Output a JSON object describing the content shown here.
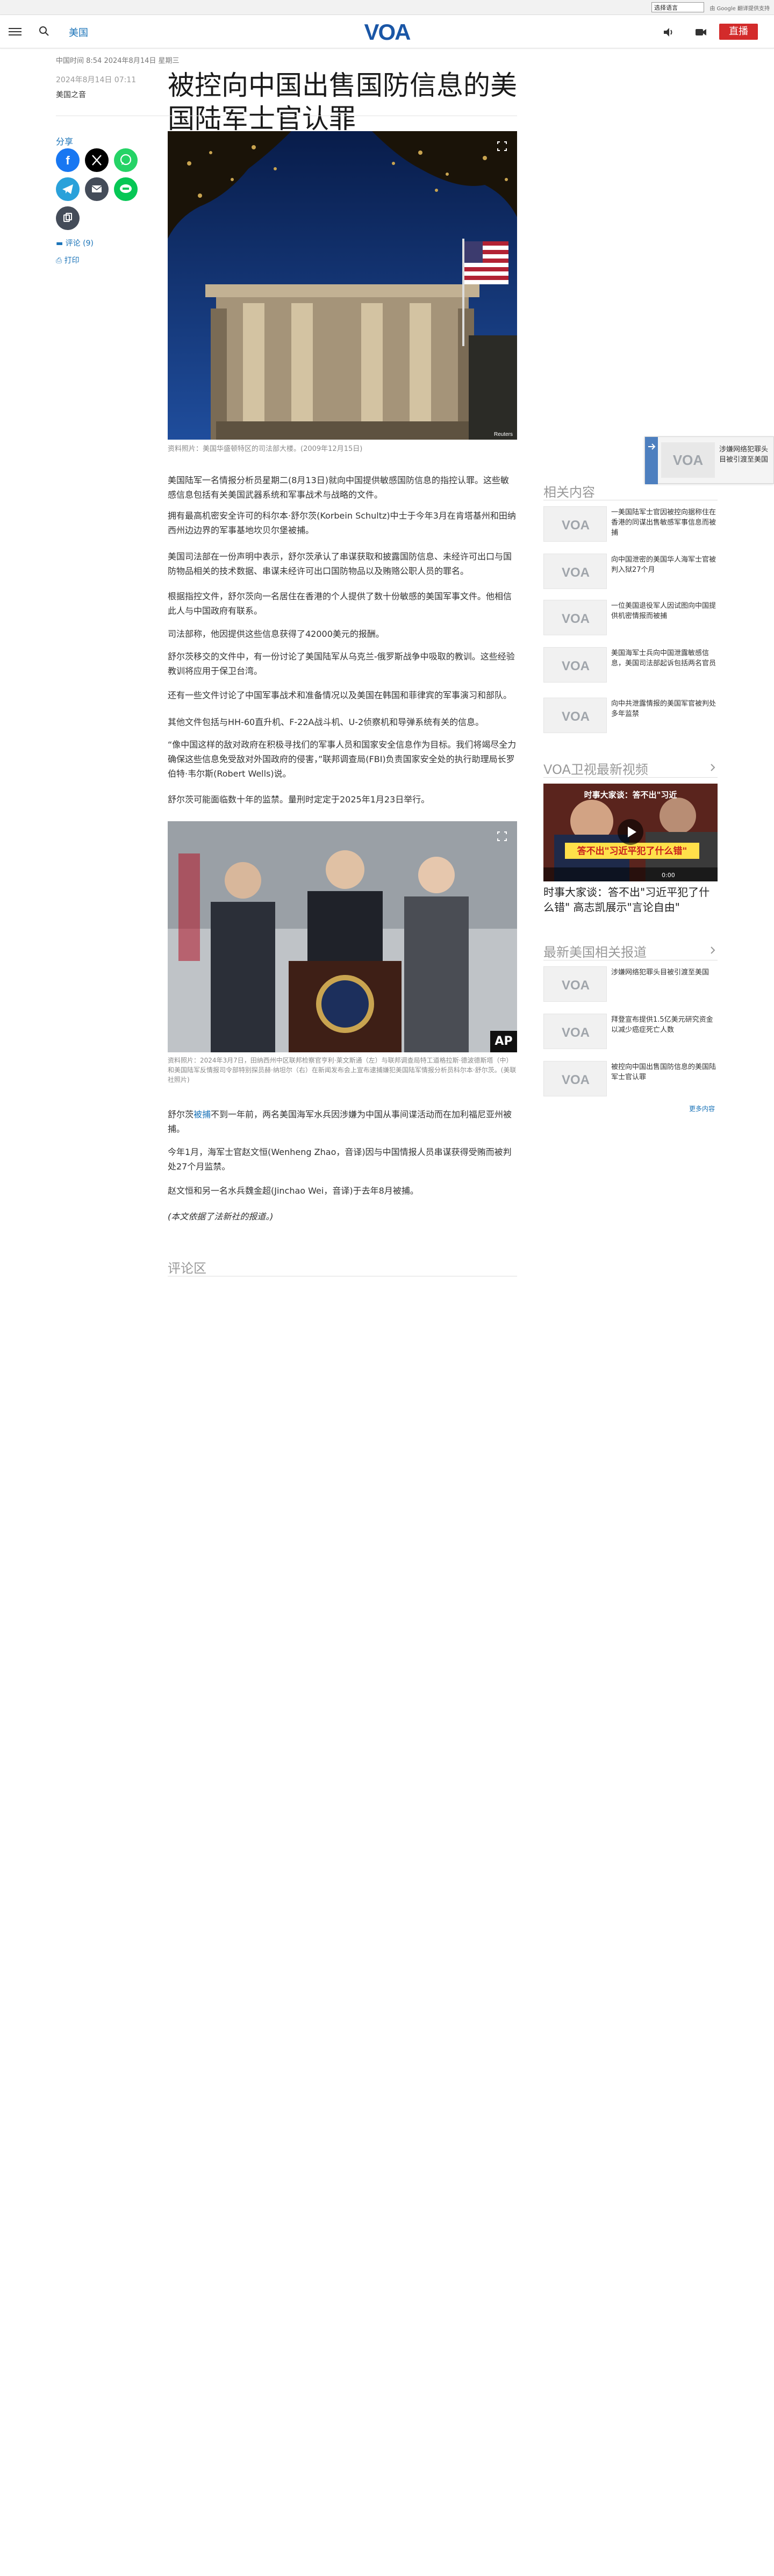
{
  "translate": {
    "select_label": "选择语言",
    "powered": "由 Google 翻译提供支持"
  },
  "header": {
    "section": "美国",
    "logo_text": "VOA",
    "live": "直播"
  },
  "article": {
    "dateline": "中国时间 8:54 2024年8月14日 星期三",
    "pub_date": "2024年8月14日 07:11",
    "author": "美国之音",
    "headline": "被控向中国出售国防信息的美国陆军士官认罪",
    "share_label": "分享",
    "comments_link": "评论 (9)",
    "print_link": "打印",
    "hero_caption": "资料照片：美国华盛顿特区的司法部大楼。(2009年12月15日)",
    "hero_credit": "Reuters",
    "paragraphs": [
      "美国陆军一名情报分析员星期二(8月13日)就向中国提供敏感国防信息的指控认罪。这些敏感信息包括有关美国武器系统和军事战术与战略的文件。",
      "拥有最高机密安全许可的科尔本·舒尔茨(Korbein Schultz)中士于今年3月在肯塔基州和田纳西州边边界的军事基地坎贝尔堡被捕。",
      "美国司法部在一份声明中表示，舒尔茨承认了串谋获取和披露国防信息、未经许可出口与国防物品相关的技术数据、串谋未经许可出口国防物品以及贿赂公职人员的罪名。",
      "根据指控文件，舒尔茨向一名居住在香港的个人提供了数十份敏感的美国军事文件。他相信此人与中国政府有联系。",
      "司法部称，他因提供这些信息获得了42000美元的报酬。",
      "舒尔茨移交的文件中，有一份讨论了美国陆军从乌克兰-俄罗斯战争中吸取的教训。这些经验教训将应用于保卫台湾。",
      "还有一些文件讨论了中国军事战术和准备情况以及美国在韩国和菲律宾的军事演习和部队。",
      "其他文件包括与HH-60直升机、F-22A战斗机、U-2侦察机和导弹系统有关的信息。",
      "“像中国这样的敌对政府在积极寻找们的军事人员和国家安全信息作为目标。我们将竭尽全力确保这些信息免受敌对外国政府的侵害，”联邦调查局(FBI)负责国家安全处的执行助理局长罗伯特·韦尔斯(Robert Wells)说。",
      "舒尔茨可能面临数十年的监禁。量刑时定定于2025年1月23日举行。"
    ],
    "photo2_caption": "资料照片：2024年3月7日，田纳西州中区联邦检察官亨利·莱文斯通（左）与联邦调查局特工道格拉斯·德波德斯塔（中）和美国陆军反情报司令部特别探员赫·纳坦尔（右）在新闻发布会上宣布逮捕嫌犯美国陆军情报分析员科尔本·舒尔茨。(美联社照片)",
    "photo2_credit": "AP",
    "paragraphs2_pre": "舒尔茨",
    "paragraphs2_link": "被捕",
    "paragraphs2_post": "不到一年前，两名美国海军水兵因涉嫌为中国从事间谍活动而在加利福尼亚州被捕。",
    "paragraphs3": "今年1月，海军士官赵文恒(Wenheng Zhao，音译)因与中国情报人员串谋获得受贿而被判处27个月监禁。",
    "paragraphs4": "赵文恒和另一名水兵魏金超(Jinchao Wei，音译)于去年8月被捕。",
    "note": "(本文依据了法新社的报道。)",
    "comments_title": "评论区"
  },
  "sidebar": {
    "related_title": "相关内容",
    "related": [
      "一美国陆军士官因被控向据称住在香港的同谋出售敏感军事信息而被捕",
      "向中国泄密的美国华人海军士官被判入狱27个月",
      "一位美国退役军人因试图向中国提供机密情报而被捕",
      "美国海军士兵向中国泄露敏感信息，美国司法部起诉包括两名官员",
      "向中共泄露情报的美国军官被判处多年监禁"
    ],
    "video_title": "VOA卫视最新视频",
    "video_overlay_top": "时事大家谈：答不出\"习近",
    "video_overlay_main": "答不出\"习近平犯了什么错\"",
    "video_time": "0:00",
    "video_caption": "时事大家谈：答不出\"习近平犯了什么错\" 高志凯展示\"言论自由\"",
    "latest_title": "最新美国相关报道",
    "latest": [
      "涉嫌网络犯罪头目被引渡至美国",
      "拜登宣布提供1.5亿美元研究资金以减少癌症死亡人数",
      "被控向中国出售国防信息的美国陆军士官认罪"
    ],
    "more": "更多内容"
  },
  "float_widget": {
    "text": "涉嫌网络犯罪头目被引渡至美国"
  },
  "colors": {
    "brand_blue": "#1a73b8",
    "live_red": "#d32b2b",
    "facebook": "#1877f2",
    "x": "#000000",
    "whatsapp": "#25d366",
    "telegram": "#2aa1da",
    "email": "#444c59",
    "line": "#06c755",
    "copy": "#444c59"
  }
}
